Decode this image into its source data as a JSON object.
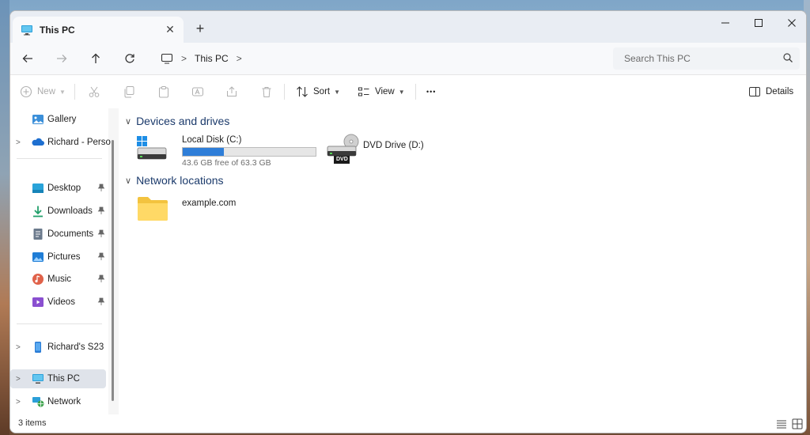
{
  "window": {
    "tab_title": "This PC",
    "new_tab": "+"
  },
  "address": {
    "crumbs": [
      "This PC"
    ],
    "search_placeholder": "Search This PC"
  },
  "commands": {
    "new": "New",
    "sort": "Sort",
    "view": "View",
    "more": "•••",
    "details": "Details"
  },
  "sidebar": {
    "items": [
      {
        "label": "Gallery",
        "icon": "gallery-icon"
      },
      {
        "label": "Richard - Personal",
        "icon": "onedrive-icon"
      },
      {
        "label": "Desktop",
        "icon": "desktop-icon",
        "pinned": true
      },
      {
        "label": "Downloads",
        "icon": "download-icon",
        "pinned": true
      },
      {
        "label": "Documents",
        "icon": "documents-icon",
        "pinned": true
      },
      {
        "label": "Pictures",
        "icon": "pictures-icon",
        "pinned": true
      },
      {
        "label": "Music",
        "icon": "music-icon",
        "pinned": true
      },
      {
        "label": "Videos",
        "icon": "videos-icon",
        "pinned": true
      },
      {
        "label": "Richard's S23",
        "icon": "phone-icon"
      },
      {
        "label": "This PC",
        "icon": "pc-icon",
        "selected": true
      },
      {
        "label": "Network",
        "icon": "network-icon"
      }
    ]
  },
  "content": {
    "groups": [
      {
        "title": "Devices and drives"
      },
      {
        "title": "Network locations"
      }
    ],
    "drives": [
      {
        "name": "Local Disk (C:)",
        "free_text": "43.6 GB free of 63.3 GB",
        "free_gb": 43.6,
        "total_gb": 63.3
      },
      {
        "name": "DVD Drive (D:)",
        "badge": "DVD"
      }
    ],
    "network": [
      {
        "name": "example.com"
      }
    ]
  },
  "status": {
    "items_text": "3 items"
  },
  "colors": {
    "accent": "#2f7ed8",
    "selected_bg": "#dfe3ea",
    "titlebar_bg": "#e9edf3",
    "group_header": "#1b3a6b"
  }
}
